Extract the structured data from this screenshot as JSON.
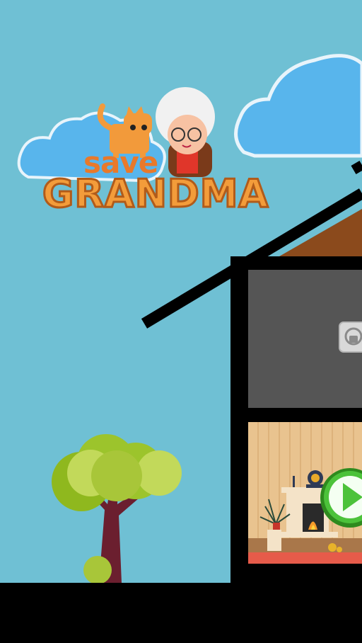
{
  "game": {
    "logo": {
      "line1": "save",
      "line2": "GRANDMA"
    },
    "levels": [
      {
        "state": "locked",
        "icon": "padlock-icon"
      },
      {
        "state": "unlocked",
        "icon": "play-icon"
      }
    ]
  },
  "colors": {
    "sky": "#6fc0d4",
    "cloud": "#5ab8ee",
    "roof": "#8b4a1c",
    "locked_room": "#555555",
    "wall_wood": "#e9c38f",
    "play_green": "#4cc23a",
    "logo_orange": "#f39c3a"
  }
}
